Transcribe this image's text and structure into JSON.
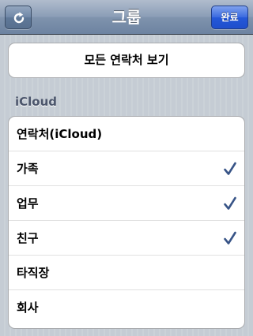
{
  "navbar": {
    "title": "그룹",
    "refresh_icon": "refresh-icon",
    "done_label": "완료"
  },
  "show_all": {
    "label": "모든 연락처 보기"
  },
  "section": {
    "header": "iCloud"
  },
  "groups": [
    {
      "label": "연락처(iCloud)",
      "checked": false
    },
    {
      "label": "가족",
      "checked": true
    },
    {
      "label": "업무",
      "checked": true
    },
    {
      "label": "친구",
      "checked": true
    },
    {
      "label": "타직장",
      "checked": false
    },
    {
      "label": "회사",
      "checked": false
    }
  ],
  "colors": {
    "checkmark": "#385487",
    "done_button": "#2458d8",
    "section_header": "#4c566c"
  }
}
